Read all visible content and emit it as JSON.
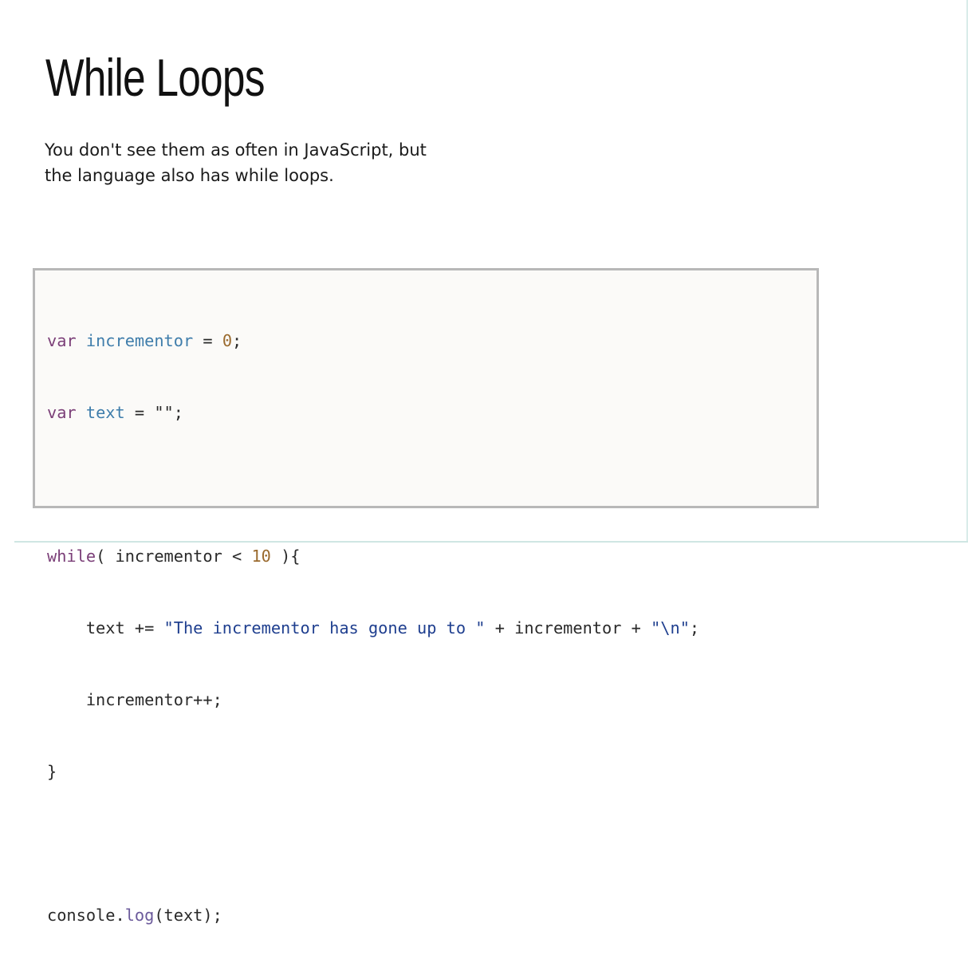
{
  "slide": {
    "title": "While Loops",
    "intro_lines": [
      "You don't see them as often in JavaScript, but",
      "the language also has while loops."
    ]
  },
  "code": {
    "line1": {
      "kw": "var",
      "name": "incrementor",
      "eq": " = ",
      "value": "0",
      "end": ";"
    },
    "line2": {
      "kw": "var",
      "name": "text",
      "eq": " = ",
      "value": "\"\"",
      "end": ";"
    },
    "line4": {
      "kw": "while",
      "open": "( incrementor < ",
      "num": "10",
      "close": " ){"
    },
    "line5": {
      "indent": "    ",
      "left": "text += ",
      "str1": "\"The incrementor has gone up to \"",
      "mid": " + incrementor + ",
      "str2": "\"\\n\"",
      "end": ";"
    },
    "line6": {
      "text": "    incrementor++;"
    },
    "line7": {
      "text": "}"
    },
    "line9": {
      "obj": "console.",
      "method": "log",
      "args": "(text);"
    }
  },
  "colors": {
    "background": "#ffffff",
    "code_background": "#fbfaf8",
    "code_border": "#b8b8b8",
    "keyword": "#7b3f78",
    "variable": "#3f7dab",
    "number": "#9a6a2e",
    "string": "#1f3f8f"
  }
}
